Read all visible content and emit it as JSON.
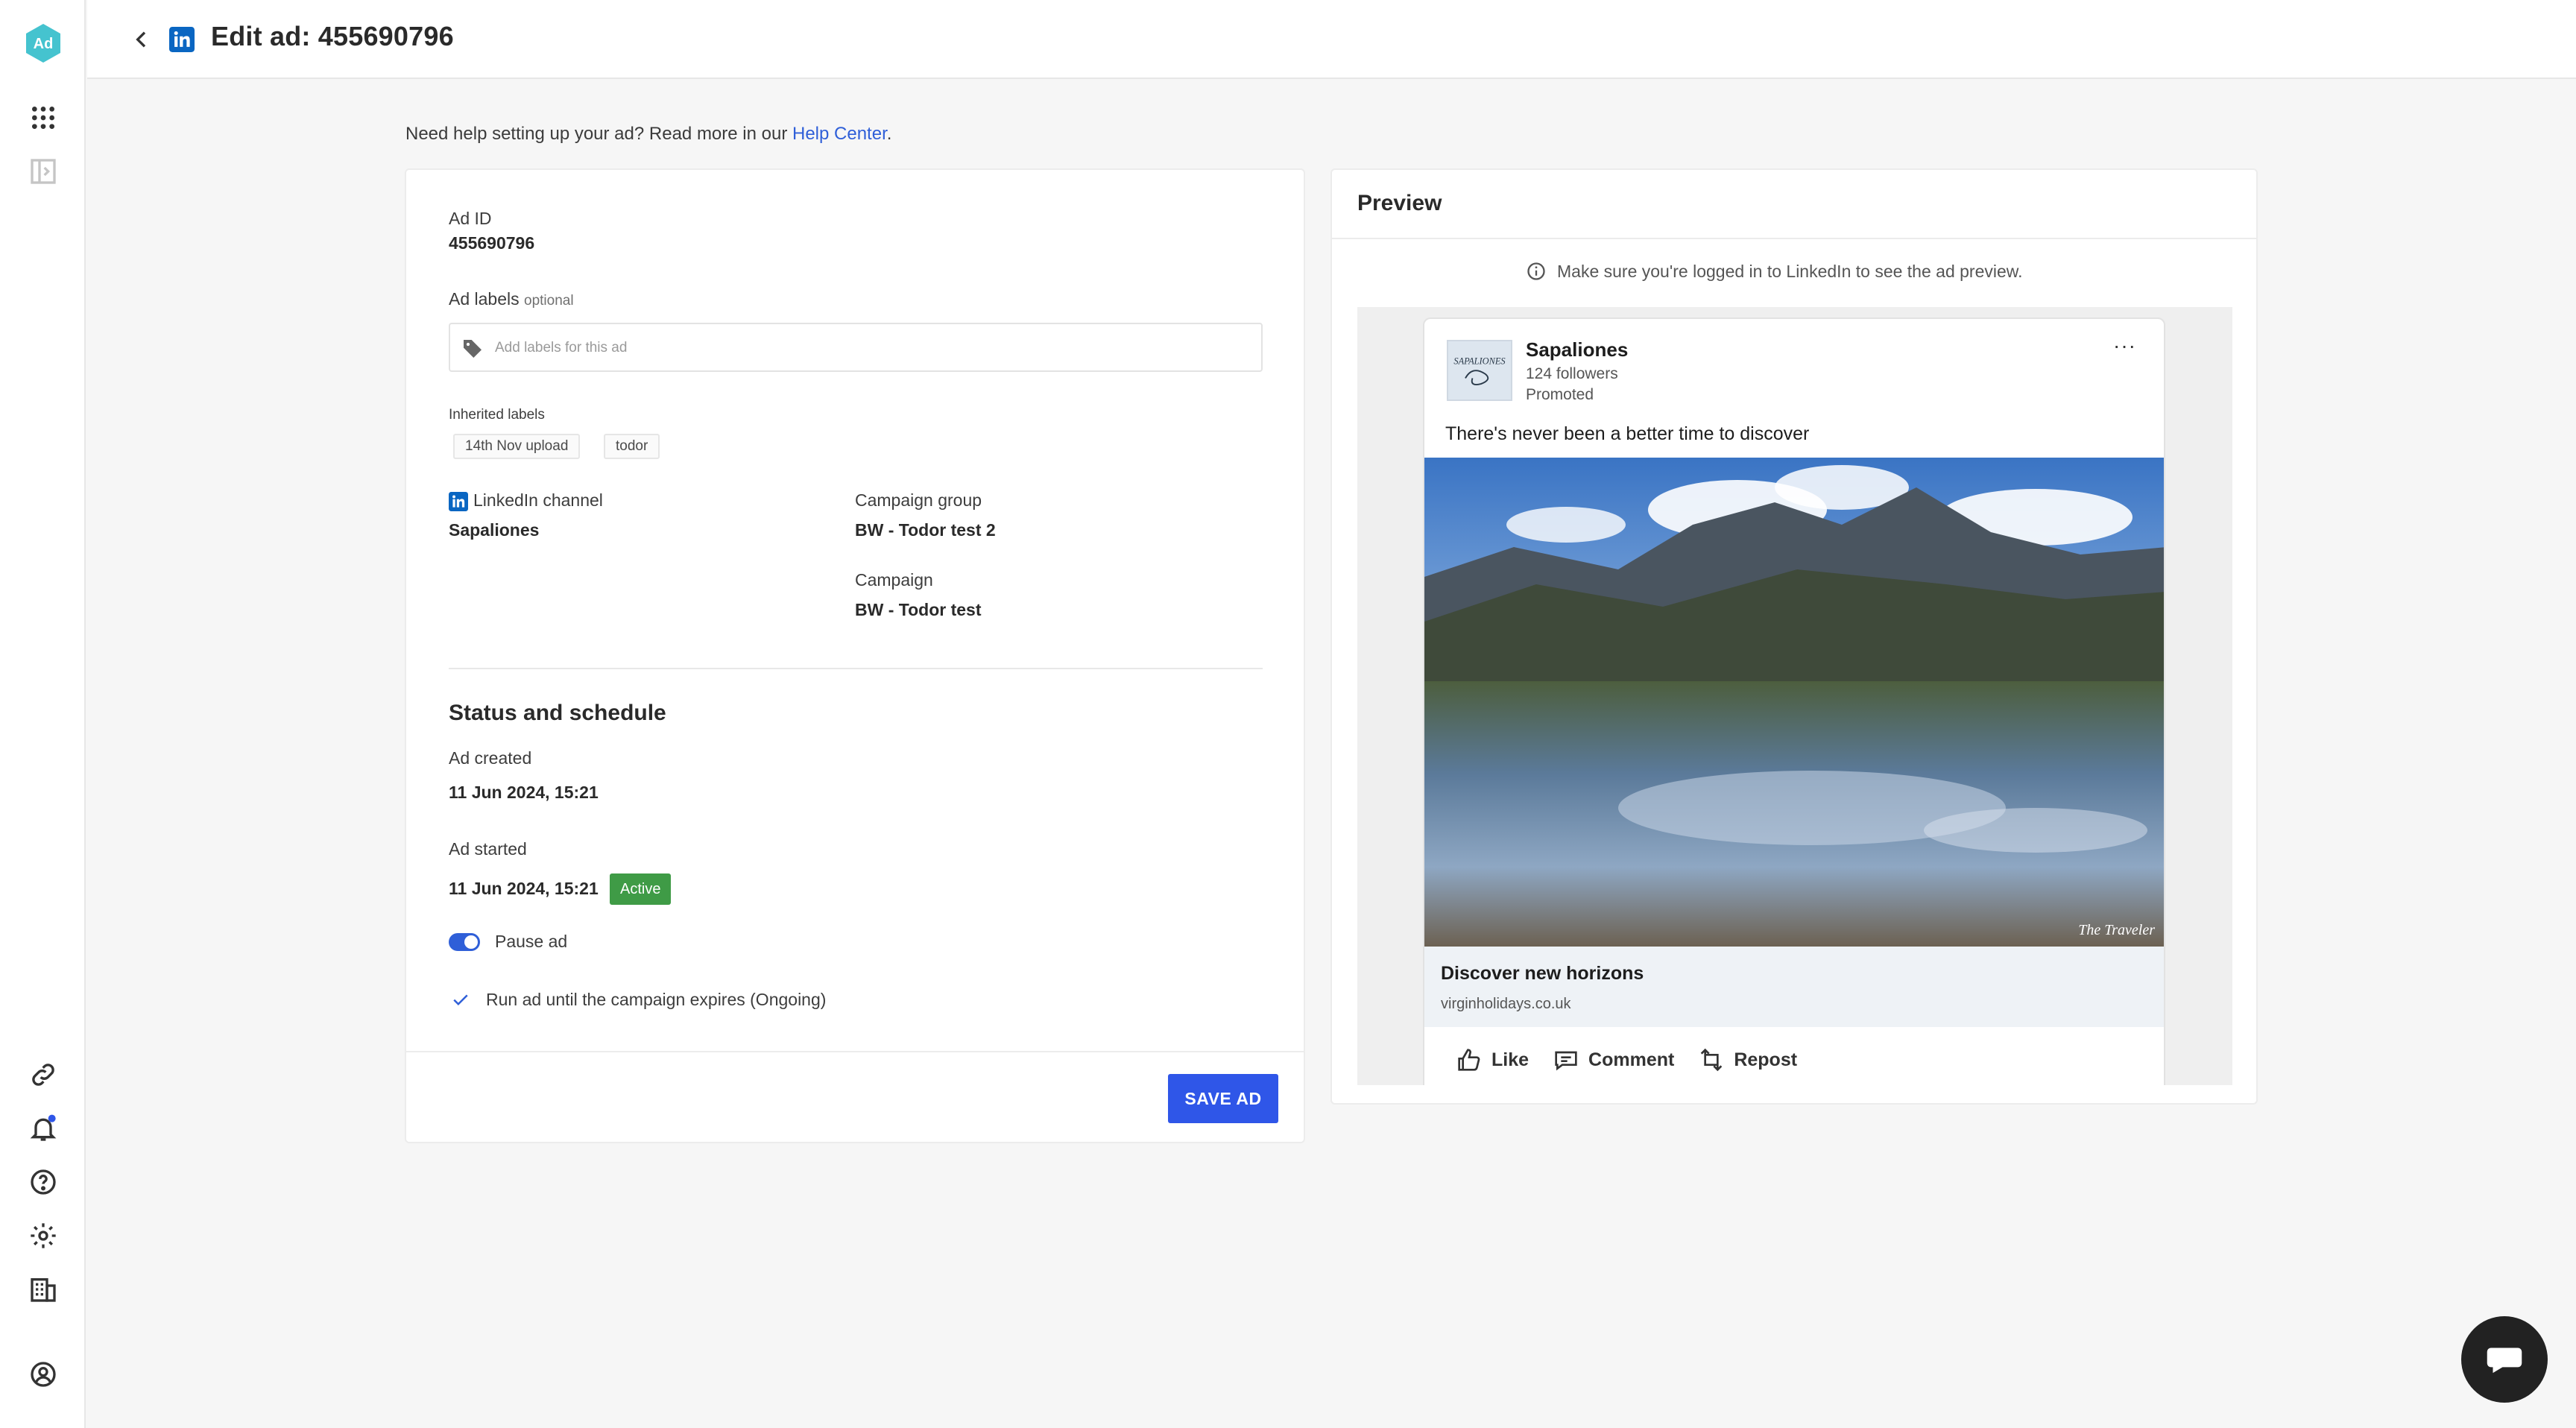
{
  "app": {
    "logo_text": "Ad",
    "colors": {
      "brand": "#2f56e8",
      "link": "#2f5fd8",
      "active": "#3f9b46",
      "linkedin": "#0a66c2",
      "logo": "#45c3cf"
    }
  },
  "rail": {
    "top_items": [
      "apps-grid-icon",
      "sidebar-toggle-icon"
    ],
    "bottom_items": [
      "link-icon",
      "bell-icon",
      "help-icon",
      "gear-icon",
      "building-icon",
      "account-icon"
    ]
  },
  "header": {
    "title": "Edit ad: 455690796"
  },
  "help": {
    "prefix": "Need help setting up your ad? Read more in our ",
    "link": "Help Center",
    "suffix": "."
  },
  "form": {
    "ad_id_label": "Ad ID",
    "ad_id_value": "455690796",
    "ad_labels_label": "Ad labels",
    "ad_labels_optional": "optional",
    "ad_labels_placeholder": "Add labels for this ad",
    "inherited_label": "Inherited labels",
    "inherited": [
      "14th Nov upload",
      "todor"
    ],
    "channel_label": "LinkedIn channel",
    "channel_value": "Sapaliones",
    "campaign_group_label": "Campaign group",
    "campaign_group_value": "BW - Todor test 2",
    "campaign_label": "Campaign",
    "campaign_value": "BW - Todor test",
    "status_title": "Status and schedule",
    "created_label": "Ad created",
    "created_value": "11 Jun 2024, 15:21",
    "started_label": "Ad started",
    "started_value": "11 Jun 2024, 15:21",
    "status_badge": "Active",
    "pause_label": "Pause ad",
    "run_label": "Run ad until the campaign expires (Ongoing)",
    "save_button": "SAVE AD"
  },
  "preview": {
    "title": "Preview",
    "notice": "Make sure you're logged in to LinkedIn to see the ad preview.",
    "post": {
      "page_name": "Sapaliones",
      "followers": "124 followers",
      "promoted": "Promoted",
      "more": "···",
      "text": "There's never been a better time to discover",
      "image_watermark": "The Traveler",
      "headline": "Discover new horizons",
      "domain": "virginholidays.co.uk",
      "actions": [
        "Like",
        "Comment",
        "Repost"
      ]
    }
  }
}
